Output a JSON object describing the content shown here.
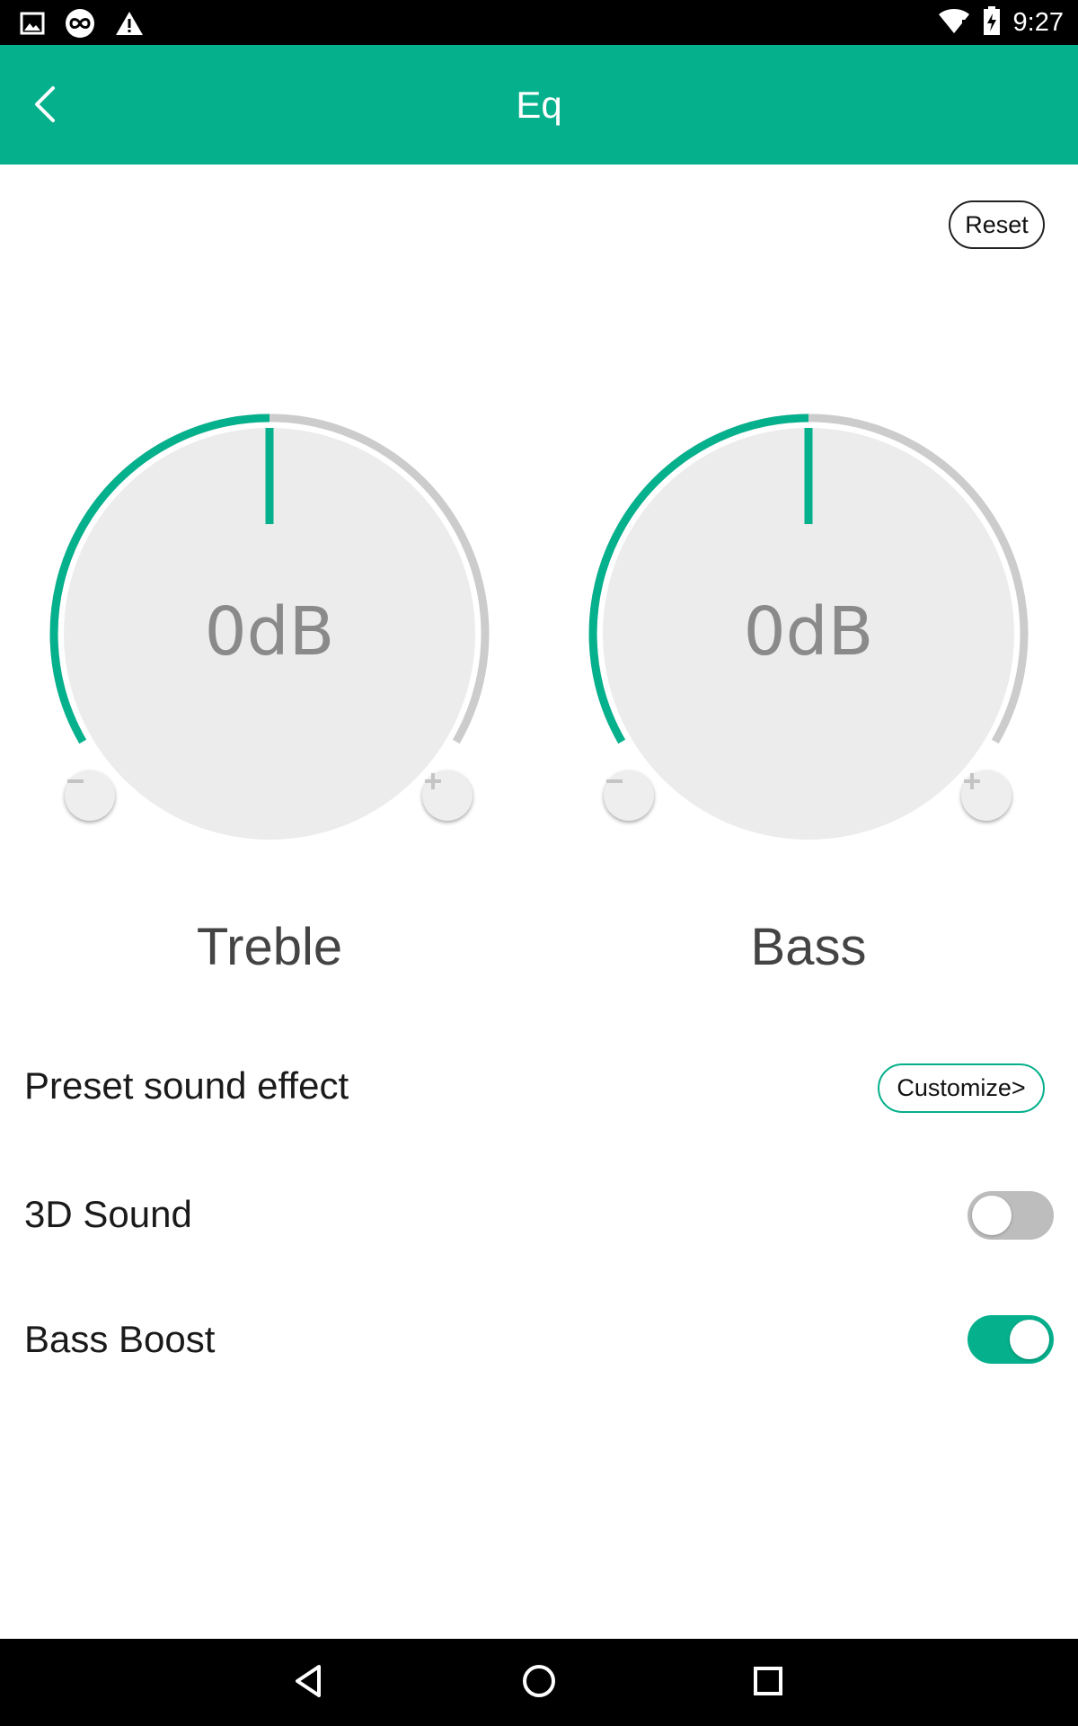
{
  "status_bar": {
    "time": "9:27",
    "icons": [
      "image-icon",
      "infinity-circle-icon",
      "warning-icon",
      "wifi-icon",
      "battery-icon"
    ]
  },
  "app_bar": {
    "title": "Eq",
    "back_icon": "chevron-left-icon"
  },
  "reset_label": "Reset",
  "knobs": [
    {
      "label": "Treble",
      "value_text": "0dB",
      "level": 0.5
    },
    {
      "label": "Bass",
      "value_text": "0dB",
      "level": 0.5
    }
  ],
  "settings": {
    "preset_label": "Preset sound effect",
    "customize_label": "Customize>",
    "sound3d_label": "3D Sound",
    "sound3d_on": false,
    "bass_boost_label": "Bass Boost",
    "bass_boost_on": true
  },
  "colors": {
    "accent": "#05b08c",
    "status_bar": "#000000",
    "knob_face": "#ececec",
    "track_inactive": "#cccccc"
  },
  "nav_bar": {
    "icons": [
      "back-triangle-icon",
      "home-circle-icon",
      "recents-square-icon"
    ]
  }
}
